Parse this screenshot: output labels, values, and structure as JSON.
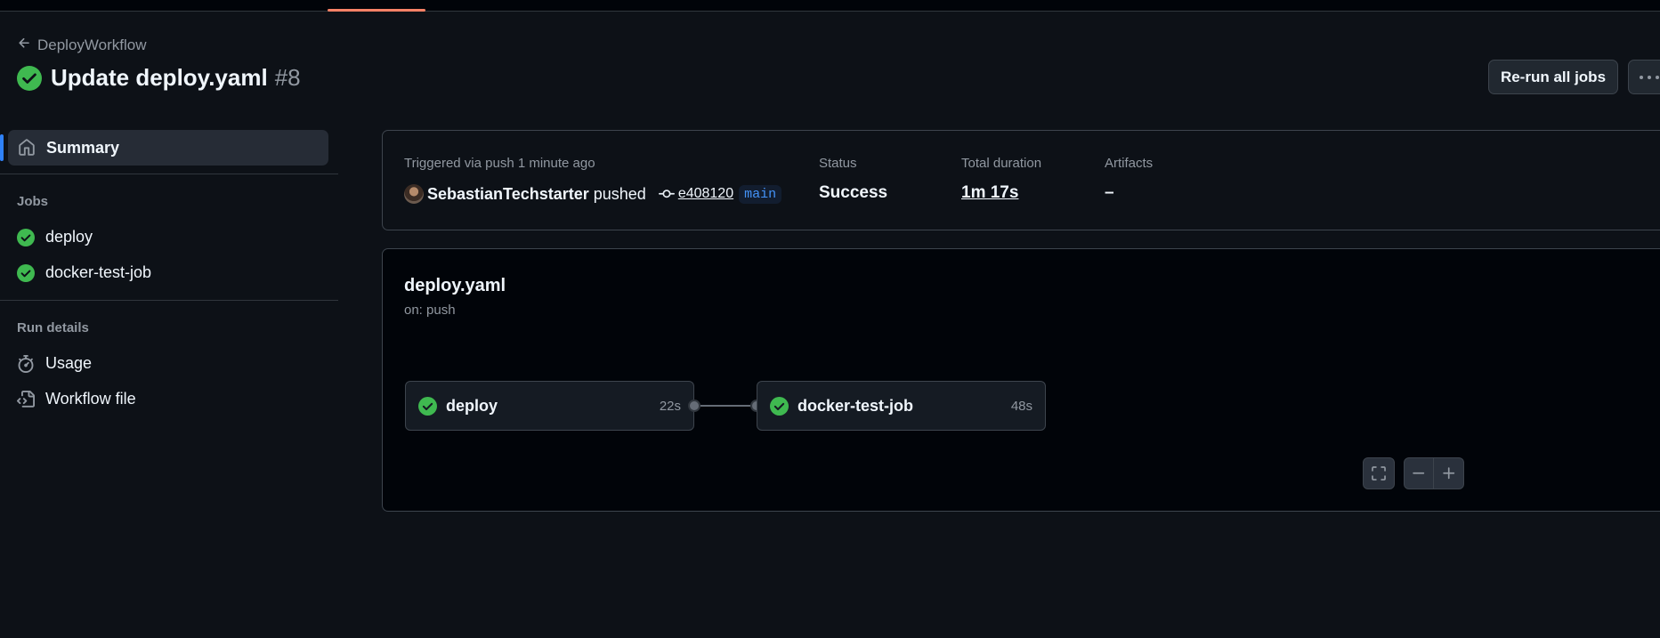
{
  "nav": {
    "back_label": "DeployWorkflow"
  },
  "header": {
    "title": "Update deploy.yaml",
    "run_number": "#8",
    "rerun_label": "Re-run all jobs"
  },
  "sidebar": {
    "summary_label": "Summary",
    "jobs_heading": "Jobs",
    "jobs": [
      {
        "label": "deploy"
      },
      {
        "label": "docker-test-job"
      }
    ],
    "run_details_heading": "Run details",
    "usage_label": "Usage",
    "workflow_file_label": "Workflow file"
  },
  "summary": {
    "trigger_text": "Triggered via push 1 minute ago",
    "actor": "SebastianTechstarter",
    "action": "pushed",
    "commit": "e408120",
    "branch": "main",
    "status_label": "Status",
    "status_value": "Success",
    "duration_label": "Total duration",
    "duration_value": "1m 17s",
    "artifacts_label": "Artifacts",
    "artifacts_value": "–"
  },
  "graph": {
    "workflow_name": "deploy.yaml",
    "trigger": "on: push",
    "jobs": [
      {
        "name": "deploy",
        "duration": "22s"
      },
      {
        "name": "docker-test-job",
        "duration": "48s"
      }
    ]
  },
  "colors": {
    "success": "#3fb950",
    "accent": "#2f81f7",
    "background": "#0d1117"
  },
  "icons": {
    "back": "arrow-left-icon",
    "status": "check-circle-icon",
    "summary": "home-icon",
    "usage": "stopwatch-icon",
    "workflow_file": "file-code-icon",
    "commit": "git-commit-icon",
    "more": "kebab-horizontal-icon",
    "fullscreen": "screen-full-icon",
    "zoom_out": "dash-icon",
    "zoom_in": "plus-icon"
  }
}
